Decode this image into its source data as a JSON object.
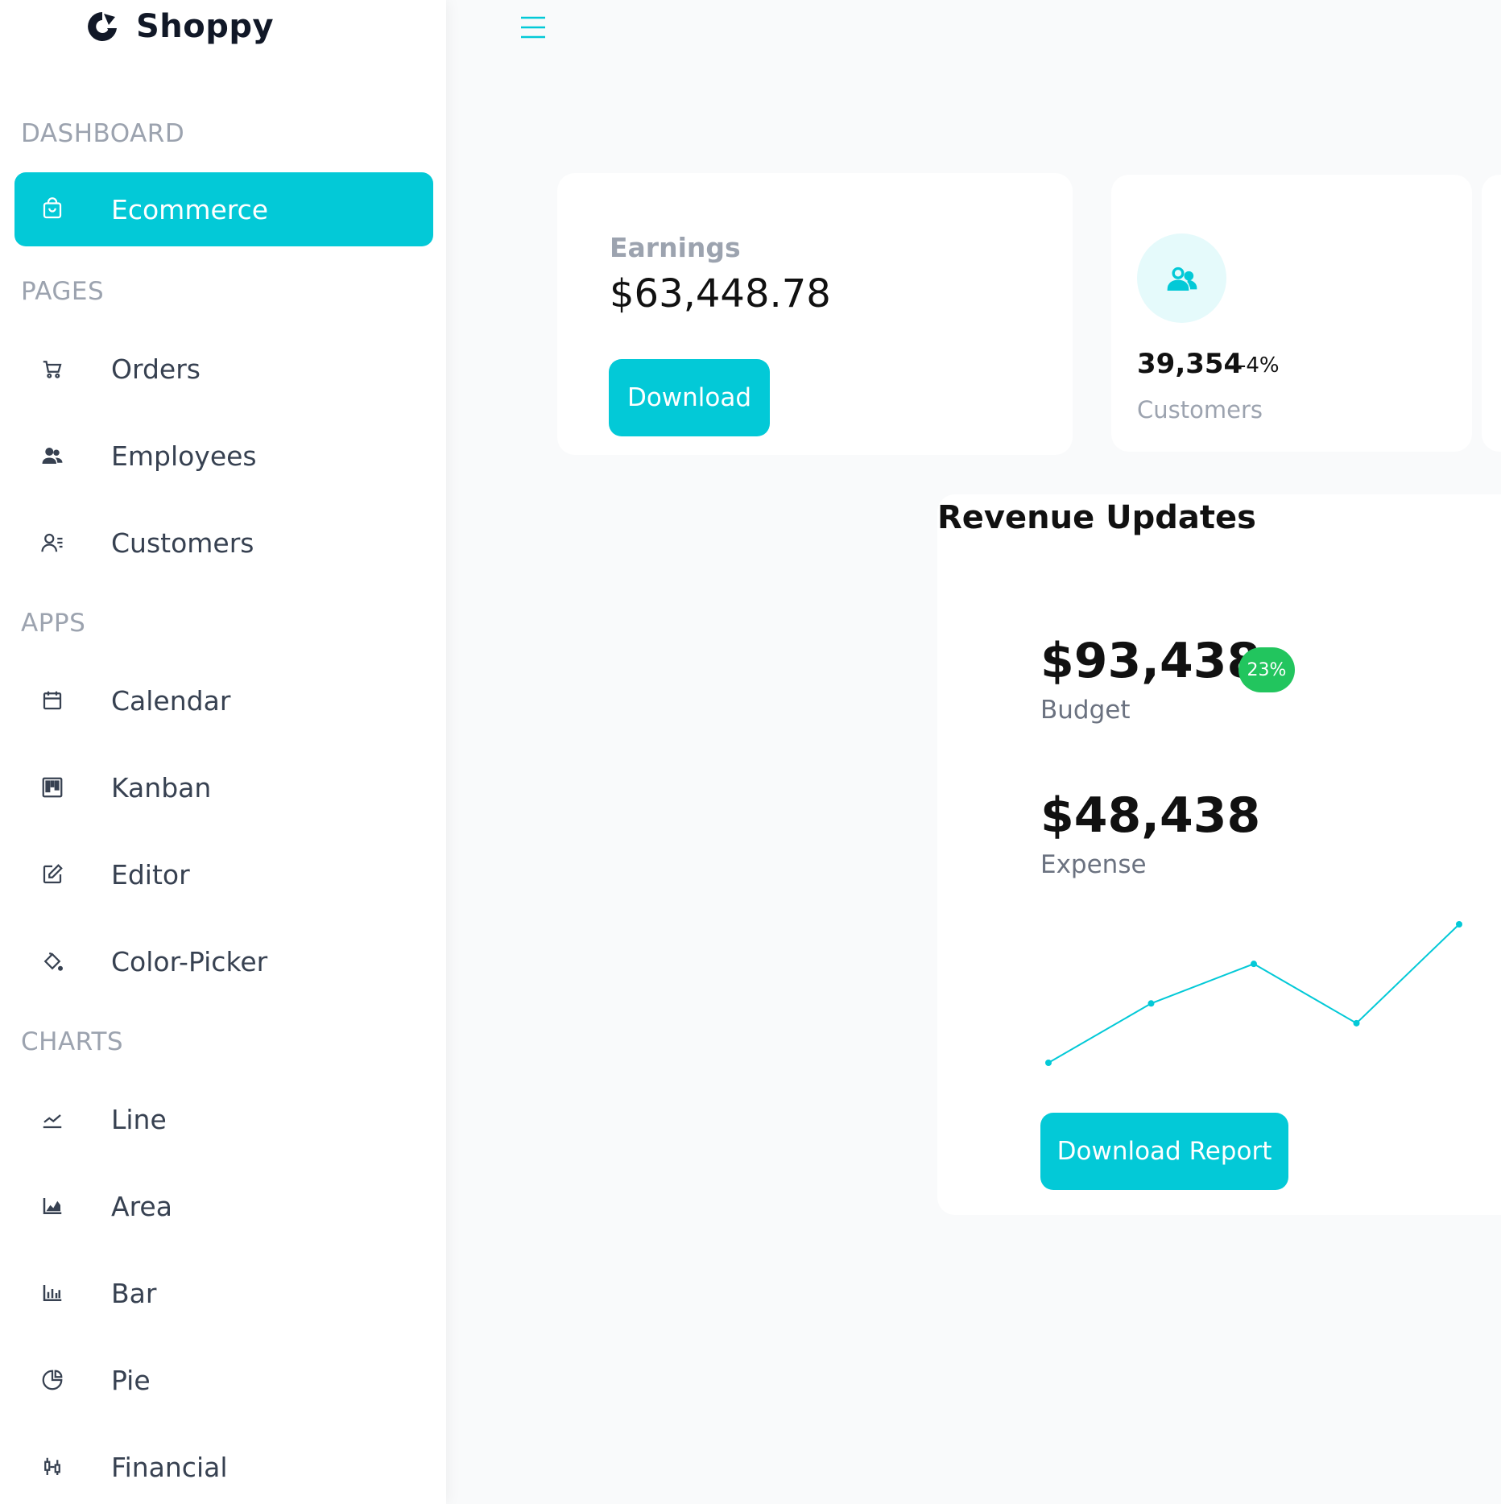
{
  "brand": {
    "name": "Shoppy"
  },
  "sidebar": {
    "sections": [
      {
        "title": "DASHBOARD"
      },
      {
        "title": "PAGES"
      },
      {
        "title": "APPS"
      },
      {
        "title": "CHARTS"
      }
    ],
    "items": [
      {
        "label": "Ecommerce",
        "icon": "shopping-bag-icon",
        "active": true
      },
      {
        "label": "Orders",
        "icon": "cart-icon"
      },
      {
        "label": "Employees",
        "icon": "people-icon"
      },
      {
        "label": "Customers",
        "icon": "user-list-icon"
      },
      {
        "label": "Calendar",
        "icon": "calendar-icon"
      },
      {
        "label": "Kanban",
        "icon": "kanban-icon"
      },
      {
        "label": "Editor",
        "icon": "edit-icon"
      },
      {
        "label": "Color-Picker",
        "icon": "paint-bucket-icon"
      },
      {
        "label": "Line",
        "icon": "line-chart-icon"
      },
      {
        "label": "Area",
        "icon": "area-chart-icon"
      },
      {
        "label": "Bar",
        "icon": "bar-chart-icon"
      },
      {
        "label": "Pie",
        "icon": "pie-chart-icon"
      },
      {
        "label": "Financial",
        "icon": "candlestick-icon"
      }
    ]
  },
  "earnings": {
    "title": "Earnings",
    "value": "$63,448.78",
    "button": "Download"
  },
  "customers_card": {
    "count": "39,354",
    "change": "-4%",
    "label": "Customers"
  },
  "revenue": {
    "title": "Revenue Updates",
    "budget": "$93,438",
    "budget_badge": "23%",
    "budget_label": "Budget",
    "expense": "$48,438",
    "expense_label": "Expense",
    "button": "Download Report",
    "sparkline": [
      1,
      4,
      6,
      3,
      8
    ]
  },
  "colors": {
    "accent": "#03c9d7",
    "badge": "#22c55e",
    "muted": "#9ca3af"
  }
}
